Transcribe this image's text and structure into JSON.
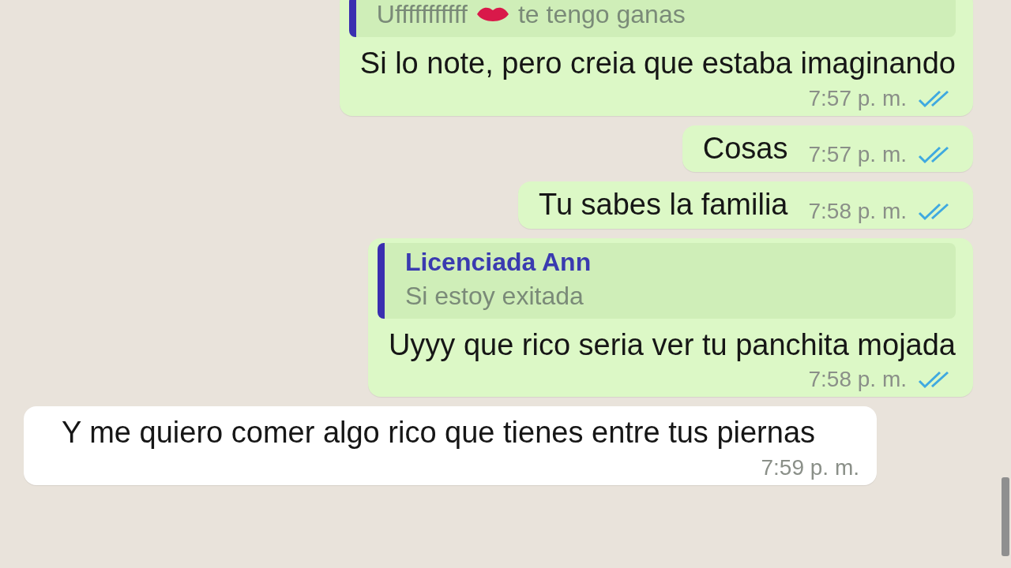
{
  "messages": [
    {
      "kind": "out",
      "quote": {
        "parts": [
          "Ufffffffffff",
          "te tengo ganas"
        ]
      },
      "text": "Si lo note, pero creia que estaba imaginando",
      "time": "7:57 p. m.",
      "read": true
    },
    {
      "kind": "out",
      "text": "Cosas",
      "time": "7:57 p. m.",
      "read": true
    },
    {
      "kind": "out",
      "text": "Tu sabes la familia",
      "time": "7:58 p. m.",
      "read": true
    },
    {
      "kind": "out",
      "quote": {
        "author": "Licenciada Ann",
        "parts": [
          "Si estoy exitada"
        ]
      },
      "text": "Uyyy que rico seria ver tu panchita mojada",
      "time": "7:58 p. m.",
      "read": true
    },
    {
      "kind": "in",
      "text": "Y me quiero comer algo rico que tienes entre tus piernas",
      "time": "7:59 p. m."
    }
  ]
}
